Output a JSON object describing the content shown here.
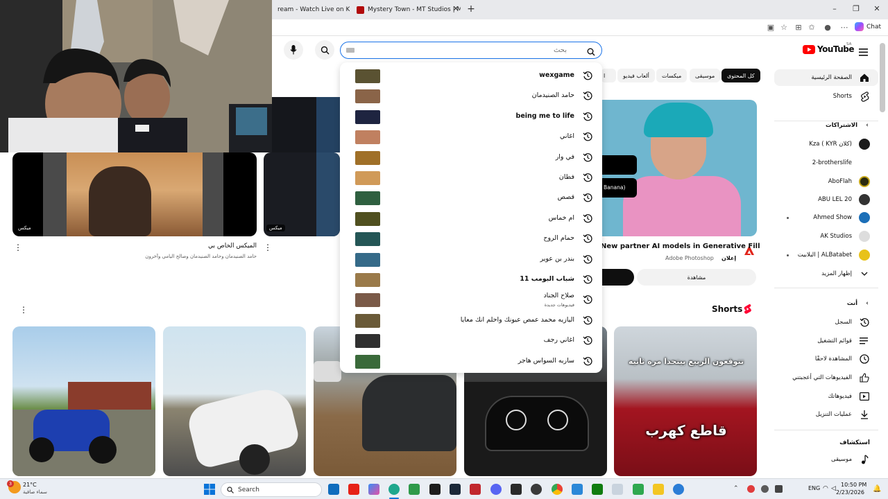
{
  "browser": {
    "tabs": [
      {
        "label": "ream - Watch Live on Kick"
      },
      {
        "label": "Mystery Town - MT Studios | MTRP"
      }
    ],
    "chat_label": "Chat"
  },
  "youtube": {
    "logo": "YouTube",
    "country": "SA",
    "search": {
      "placeholder": "بحث",
      "value": ""
    },
    "chips": [
      "كل المحتوى",
      "موسيقى",
      "ميكسات",
      "ألعاب فيديو",
      "ا"
    ]
  },
  "sidebar": {
    "main": [
      {
        "label": "الصفحة الرئيسية",
        "icon": "home-icon"
      },
      {
        "label": "Shorts",
        "icon": "shorts-icon"
      }
    ],
    "subscriptions_title": "الاشتراكات",
    "channels": [
      {
        "label": "Kza ( KYR كلان)",
        "live": false
      },
      {
        "label": "2-brotherslife",
        "live": false
      },
      {
        "label": "AboFlah",
        "live": false
      },
      {
        "label": "ABU LEL 20",
        "live": false
      },
      {
        "label": "Ahmed Show",
        "live": true
      },
      {
        "label": "AK Studios",
        "live": false
      },
      {
        "label": "البلابيت | ALBatabet",
        "live": true
      }
    ],
    "show_more": "إظهار المزيد",
    "you_title": "أنت",
    "you_items": [
      {
        "label": "السجل",
        "icon": "history-icon"
      },
      {
        "label": "قوائم التشغيل",
        "icon": "playlist-icon"
      },
      {
        "label": "المشاهدة لاحقًا",
        "icon": "clock-icon"
      },
      {
        "label": "الفيديوهات التي أعجبتني",
        "icon": "like-icon"
      },
      {
        "label": "فيديوهاتك",
        "icon": "video-icon"
      },
      {
        "label": "عمليات التنزيل",
        "icon": "download-icon"
      }
    ],
    "explore_title": "استكشاف",
    "explore_items": [
      {
        "label": "موسيقى",
        "icon": "music-icon"
      }
    ]
  },
  "suggestions": [
    {
      "text": "wexgame",
      "bold": true,
      "thumb": "#5a5232"
    },
    {
      "text": "حامد الصنيدمان",
      "bold": false,
      "thumb": "#8a6448"
    },
    {
      "text": "being me to life",
      "bold": true,
      "thumb": "#1e2440"
    },
    {
      "text": "اغاني",
      "bold": false,
      "thumb": "#c08060"
    },
    {
      "text": "في وار",
      "bold": false,
      "thumb": "#a07028"
    },
    {
      "text": "فطان",
      "bold": false,
      "thumb": "#d09a58"
    },
    {
      "text": "قصص",
      "bold": false,
      "thumb": "#2f6040"
    },
    {
      "text": "ام خماس",
      "bold": false,
      "thumb": "#505020"
    },
    {
      "text": "حمام الروح",
      "bold": false,
      "thumb": "#245656"
    },
    {
      "text": "بندر بن عوير",
      "bold": false,
      "thumb": "#356a88"
    },
    {
      "text": "شباب البومب 11",
      "bold": true,
      "thumb": "#9a7a4a"
    },
    {
      "text": "صلاح الجناد",
      "bold": false,
      "thumb": "#7a5a48",
      "sub": "فيديوهات جديدة"
    },
    {
      "text": "اليازيه محمد عمص عيونك واحلم انك معايا",
      "bold": false,
      "thumb": "#6a5a38"
    },
    {
      "text": "اغاني رجف",
      "bold": false,
      "thumb": "#303030"
    },
    {
      "text": "ساريه السواس هاجر",
      "bold": false,
      "thumb": "#3a6a3a"
    }
  ],
  "feed": {
    "video1": {
      "title": "الميكس الخاص بي",
      "channels": "حامد الصنيدمان وحامد الصنيدمان وصالح اليامي وآخرون",
      "badge": "ميكس"
    },
    "video2": {
      "badge": "ميكس"
    },
    "ad": {
      "title": "New partner AI models in Generative Fill",
      "advertiser": "Adobe Photoshop",
      "ad_label": "إعلان",
      "watch_label": "مشاهدة",
      "overlay": "Banana)"
    },
    "shorts_title": "Shorts",
    "short_captions": {
      "s5_top": "تتوقعون الربيع بيتحدا مره ثانيه",
      "s5_big": "قاطع كهرب"
    }
  },
  "taskbar": {
    "weather_temp": "21°C",
    "weather_desc": "سماء صافية",
    "search_label": "Search",
    "lang": "ENG",
    "time": "10:50 PM",
    "date": "2/23/2026",
    "notif_count": "3"
  }
}
